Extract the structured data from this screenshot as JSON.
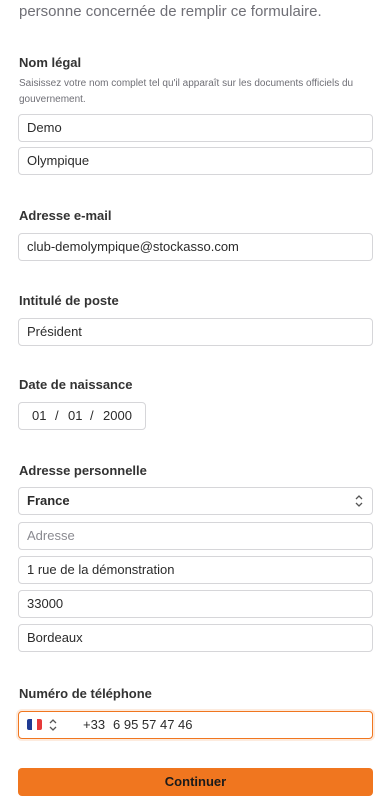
{
  "intro_text": "personne concernée de remplir ce formulaire.",
  "legal_name": {
    "label": "Nom légal",
    "help": "Saisissez votre nom complet tel qu'il apparaît sur les documents officiels du gouvernement.",
    "first_name": "Demo",
    "last_name": "Olympique"
  },
  "email": {
    "label": "Adresse e-mail",
    "value": "club-demolympique@stockasso.com"
  },
  "job_title": {
    "label": "Intitulé de poste",
    "value": "Président"
  },
  "birth_date": {
    "label": "Date de naissance",
    "day": "01",
    "month": "01",
    "year": "2000",
    "separator": "/"
  },
  "address": {
    "label": "Adresse personnelle",
    "country": "France",
    "line1_placeholder": "Adresse",
    "line2": "1 rue de la démonstration",
    "postal_code": "33000",
    "city": "Bordeaux"
  },
  "phone": {
    "label": "Numéro de téléphone",
    "flag_icon": "france-flag-icon",
    "country_code": "+33",
    "number": "6 95 57 47 46"
  },
  "submit_label": "Continuer",
  "colors": {
    "accent": "#f0761f",
    "flag_blue": "#1f3a93",
    "flag_white": "#ffffff",
    "flag_red": "#e63a3a"
  }
}
